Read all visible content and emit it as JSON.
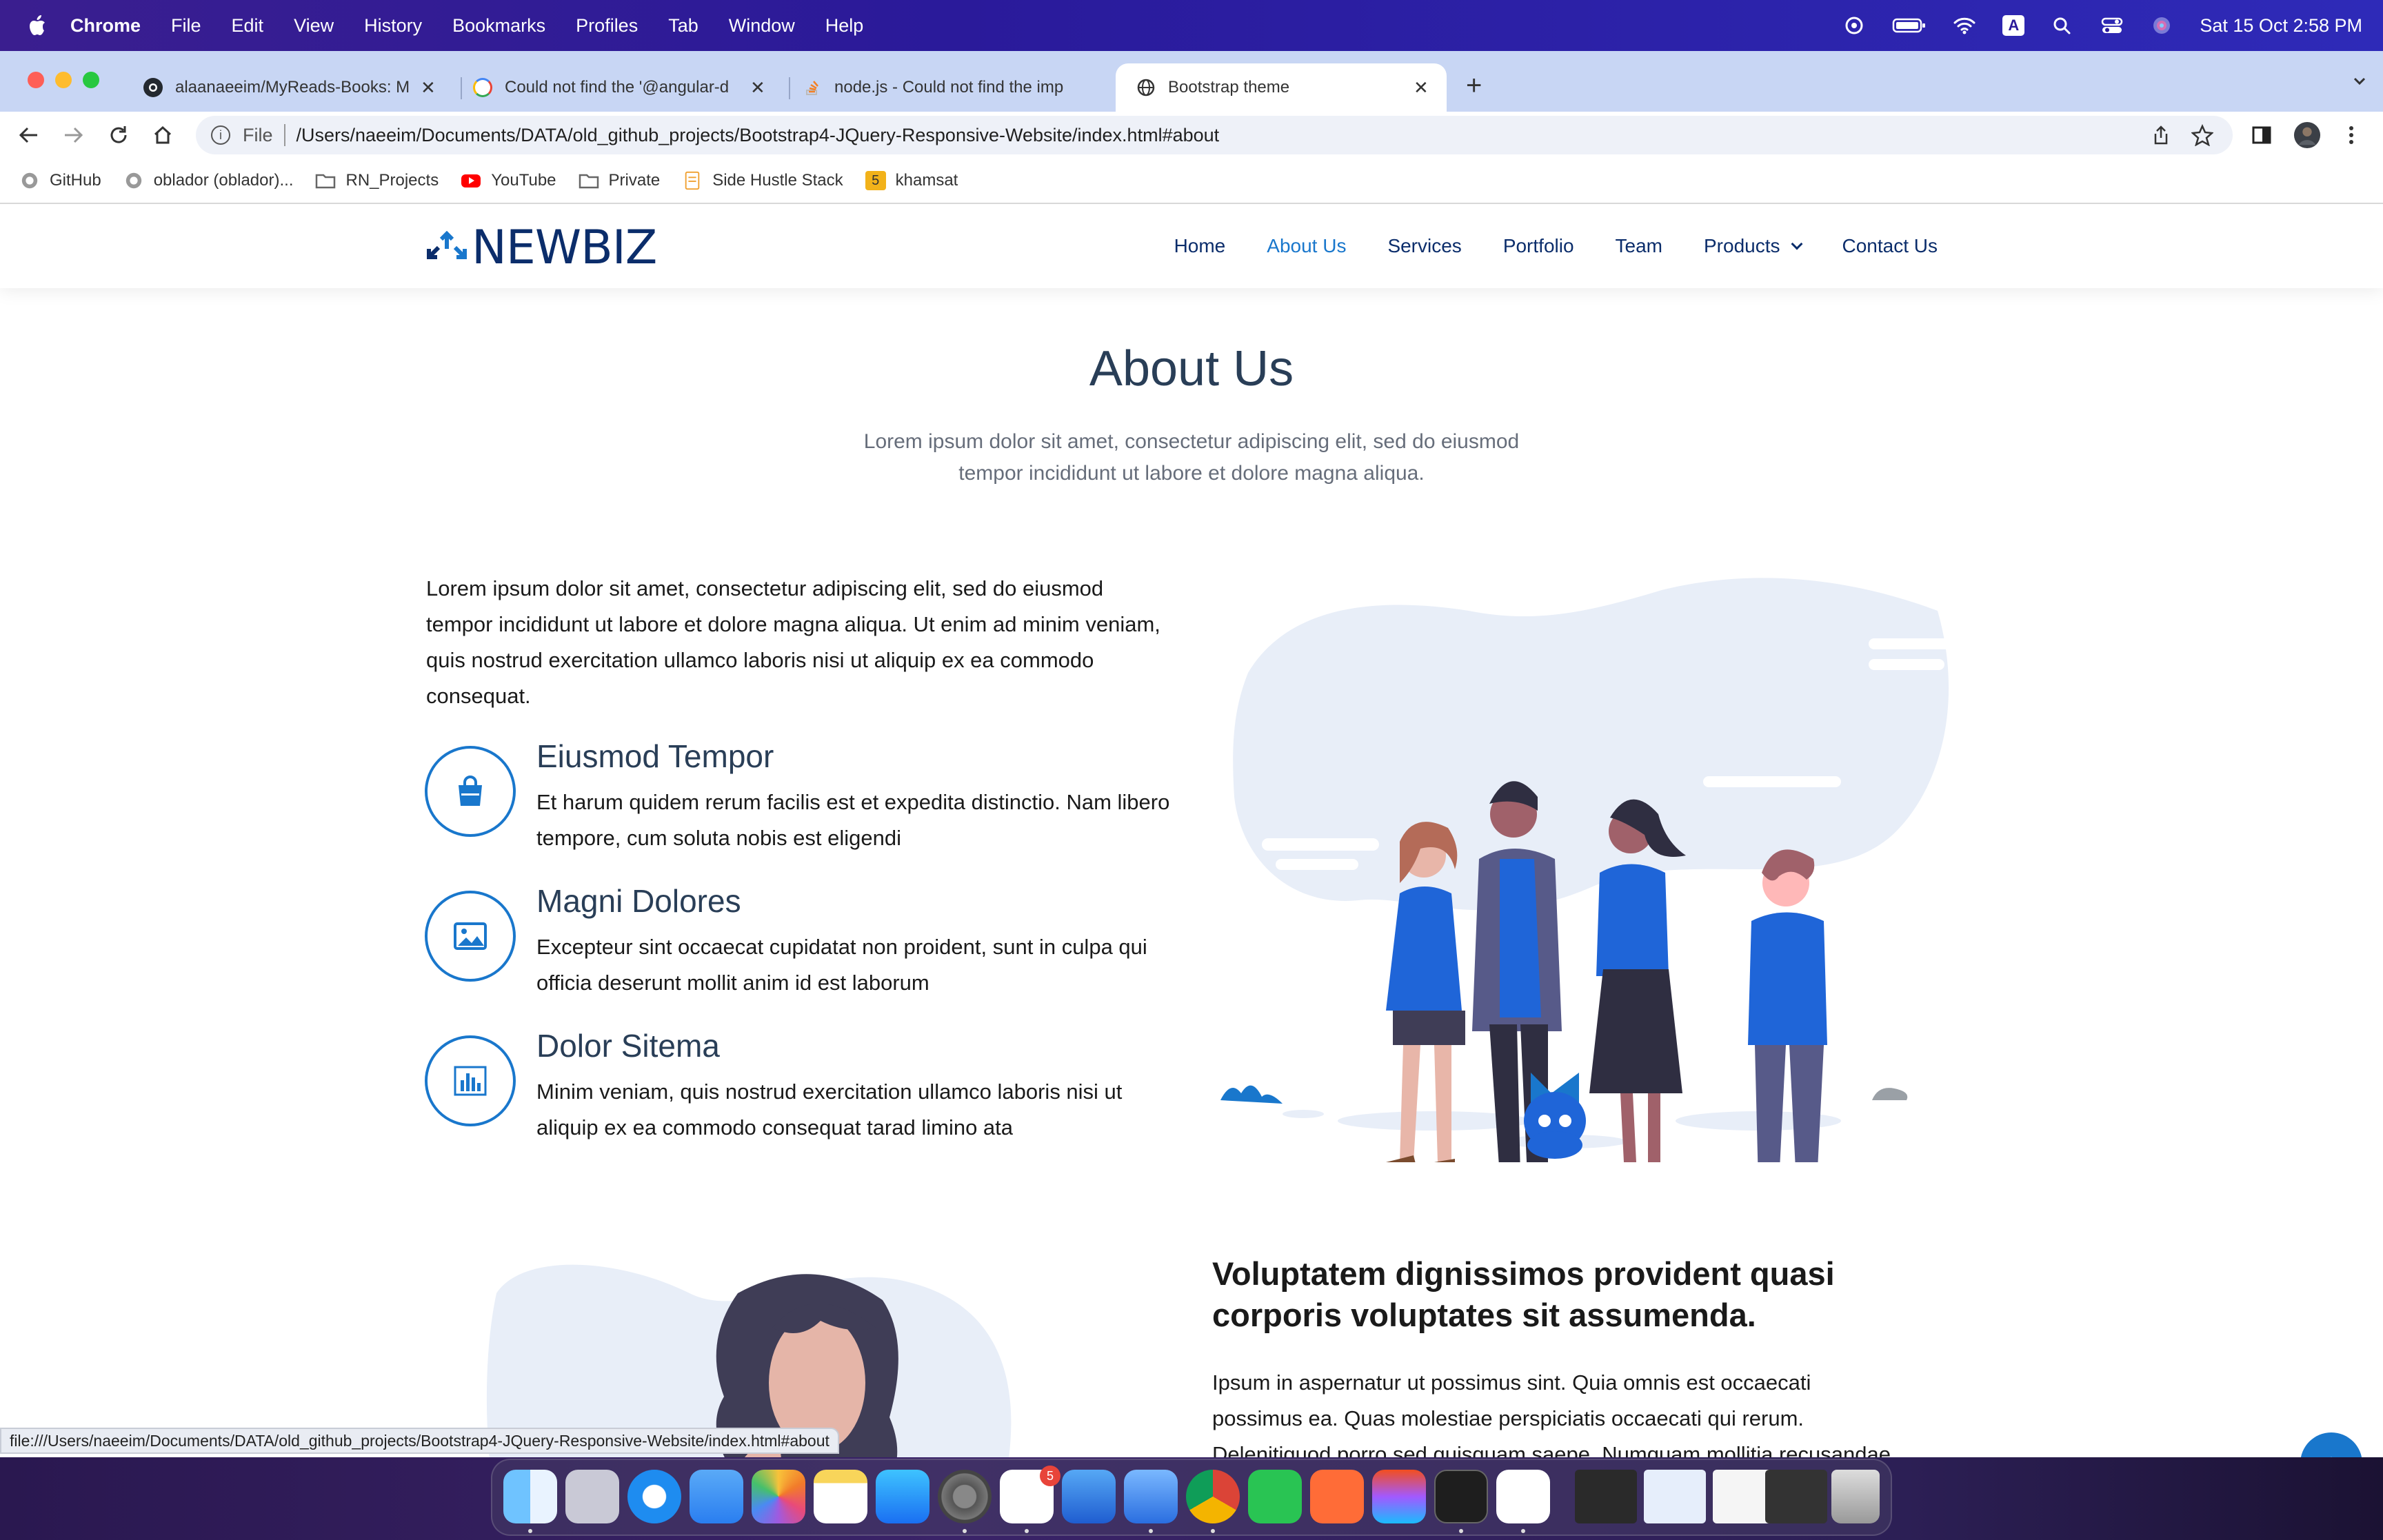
{
  "menubar": {
    "items": [
      "Chrome",
      "File",
      "Edit",
      "View",
      "History",
      "Bookmarks",
      "Profiles",
      "Tab",
      "Window",
      "Help"
    ],
    "clock": "Sat 15 Oct  2:58 PM",
    "input_source": "A"
  },
  "browser": {
    "tabs": [
      {
        "title": "alaanaeeim/MyReads-Books: M",
        "favicon": "github-icon"
      },
      {
        "title": "Could not find the '@angular-d",
        "favicon": "google-icon"
      },
      {
        "title": "node.js - Could not find the imp",
        "favicon": "stackoverflow-icon"
      },
      {
        "title": "Bootstrap theme",
        "favicon": "globe-icon",
        "active": true
      }
    ],
    "new_tab": "+",
    "address": {
      "scheme": "File",
      "url": "/Users/naeeim/Documents/DATA/old_github_projects/Bootstrap4-JQuery-Responsive-Website/index.html#about"
    },
    "bookmarks": [
      {
        "label": "GitHub",
        "icon": "github-icon"
      },
      {
        "label": "oblador (oblador)...",
        "icon": "github-icon"
      },
      {
        "label": "RN_Projects",
        "icon": "folder-icon"
      },
      {
        "label": "YouTube",
        "icon": "youtube-icon"
      },
      {
        "label": "Private",
        "icon": "folder-icon"
      },
      {
        "label": "Side Hustle Stack",
        "icon": "doc-icon"
      },
      {
        "label": "khamsat",
        "icon": "khamsat-icon",
        "badge": "5"
      }
    ],
    "status_url": "file:///Users/naeeim/Documents/DATA/old_github_projects/Bootstrap4-JQuery-Responsive-Website/index.html#about"
  },
  "site": {
    "logo": "NEWBIZ",
    "nav": [
      "Home",
      "About Us",
      "Services",
      "Portfolio",
      "Team",
      "Products",
      "Contact Us"
    ],
    "active_nav": "About Us",
    "about": {
      "title": "About Us",
      "subtitle": "Lorem ipsum dolor sit amet, consectetur adipiscing elit, sed do eiusmod tempor incididunt ut labore et dolore magna aliqua.",
      "intro": "Lorem ipsum dolor sit amet, consectetur adipiscing elit, sed do eiusmod tempor incididunt ut labore et dolore magna aliqua. Ut enim ad minim veniam, quis nostrud exercitation ullamco laboris nisi ut aliquip ex ea commodo consequat.",
      "features": [
        {
          "title": "Eiusmod Tempor",
          "text": "Et harum quidem rerum facilis est et expedita distinctio. Nam libero tempore, cum soluta nobis est eligendi",
          "icon": "shopping-bag-icon"
        },
        {
          "title": "Magni Dolores",
          "text": "Excepteur sint occaecat cupidatat non proident, sunt in culpa qui officia deserunt mollit anim id est laborum",
          "icon": "image-icon"
        },
        {
          "title": "Dolor Sitema",
          "text": "Minim veniam, quis nostrud exercitation ullamco laboris nisi ut aliquip ex ea commodo consequat tarad limino ata",
          "icon": "bar-chart-icon"
        }
      ],
      "second_heading": "Voluptatem dignissimos provident quasi corporis voluptates sit assumenda.",
      "second_text": "Ipsum in aspernatur ut possimus sint. Quia omnis est occaecati possimus ea. Quas molestiae perspiciatis occaecati qui rerum. Delenitiquod porro sed quisquam saepe. Numquam mollitia recusandae non ad at et a."
    }
  },
  "dock": {
    "slack_badge": "5",
    "apps": [
      "Finder",
      "Launchpad",
      "Safari",
      "Mail",
      "Photos",
      "Notes",
      "App Store",
      "System Preferences",
      "Slack",
      "Xcode",
      "Simulator",
      "Chrome",
      "WhatsApp",
      "Postman",
      "Figma",
      "Terminal",
      "VS Code"
    ]
  },
  "colors": {
    "accent": "#1977cc",
    "navy": "#0b2d6b",
    "heading": "#293e57"
  }
}
